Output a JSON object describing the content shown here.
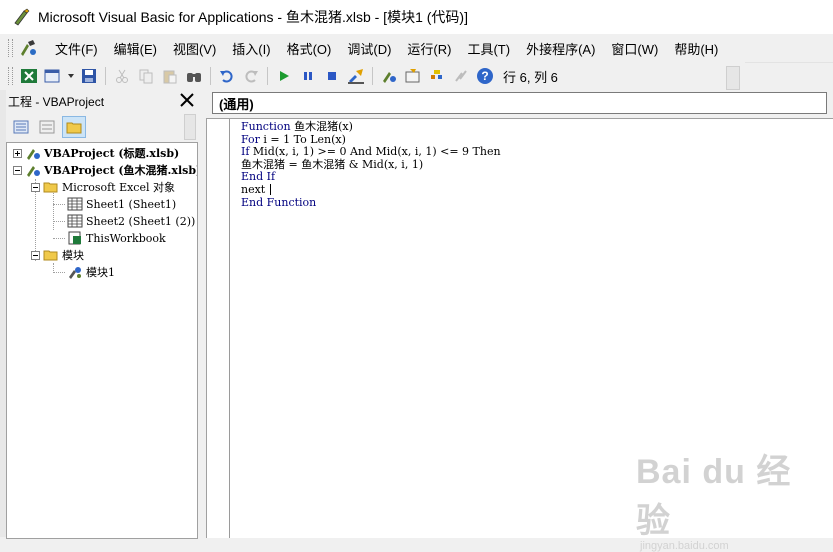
{
  "window": {
    "title": "Microsoft Visual Basic for Applications - 鱼木混猪.xlsb - [模块1 (代码)]"
  },
  "menu": {
    "items": [
      {
        "label": "文件(F)"
      },
      {
        "label": "编辑(E)"
      },
      {
        "label": "视图(V)"
      },
      {
        "label": "插入(I)"
      },
      {
        "label": "格式(O)"
      },
      {
        "label": "调试(D)"
      },
      {
        "label": "运行(R)"
      },
      {
        "label": "工具(T)"
      },
      {
        "label": "外接程序(A)"
      },
      {
        "label": "窗口(W)"
      },
      {
        "label": "帮助(H)"
      }
    ]
  },
  "toolbar": {
    "status": "行 6, 列 6",
    "colors": {
      "run": "#1c9b2f",
      "pause": "#2b57c4",
      "stop": "#2b57c4",
      "help": "#2f66c9"
    }
  },
  "project_pane": {
    "title": "工程 - VBAProject",
    "close_glyph": "✕",
    "tree": [
      {
        "label": "VBAProject (标题.xlsb)"
      },
      {
        "label": "VBAProject (鱼木混猪.xlsb)"
      },
      {
        "label": "Microsoft Excel 对象"
      },
      {
        "label": "Sheet1 (Sheet1)"
      },
      {
        "label": "Sheet2 (Sheet1 (2))"
      },
      {
        "label": "ThisWorkbook"
      },
      {
        "label": "模块"
      },
      {
        "label": "模块1"
      }
    ]
  },
  "code_window": {
    "object_combo": "(通用)",
    "lines": [
      {
        "kw": "Function",
        "rest": " 鱼木混猪(x)"
      },
      {
        "kw": "For",
        "rest": " i = 1 To Len(x)"
      },
      {
        "kw": "If",
        "rest": " Mid(x, i, 1) >= 0 And Mid(x, i, 1) <= 9 Then"
      },
      {
        "kw": "",
        "rest": "鱼木混猪 = 鱼木混猪 & Mid(x, i, 1)"
      },
      {
        "kw": "End If",
        "rest": ""
      },
      {
        "kw": "",
        "rest": "next "
      },
      {
        "kw": "End Function",
        "rest": ""
      }
    ]
  },
  "watermark": {
    "brand": "Bai du 经验",
    "url": "jingyan.baidu.com"
  }
}
